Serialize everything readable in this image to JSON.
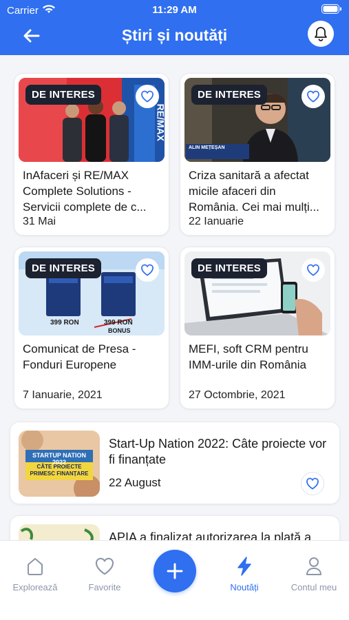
{
  "status_bar": {
    "carrier": "Carrier",
    "time": "11:29 AM"
  },
  "header": {
    "title": "Știri și noutăți"
  },
  "colors": {
    "accent": "#2f6ff0",
    "badge_bg": "#1c2230",
    "inactive": "#8d96a8"
  },
  "grid_articles": [
    {
      "badge": "DE INTERES",
      "title": "InAfaceri și RE/MAX Complete Solutions - Servicii complete de c...",
      "date": "31 Mai",
      "image_text": "RE/MAX"
    },
    {
      "badge": "DE INTERES",
      "title": "Criza sanitară a afectat micile afaceri din România. Cei mai mulți...",
      "date": "22 Ianuarie",
      "image_text": "ALIN MEȚEȘAN"
    },
    {
      "badge": "DE INTERES",
      "title": "Comunicat de Presa - Fonduri Europene",
      "date": "7 Ianuarie, 2021",
      "image_price1": "399 RON",
      "image_price2": "399 RON",
      "image_bonus": "BONUS"
    },
    {
      "badge": "DE INTERES",
      "title": "MEFI, soft CRM pentru IMM-urile din România",
      "date": "27 Octombrie, 2021"
    }
  ],
  "list_articles": [
    {
      "title": "Start-Up Nation 2022: Câte proiecte vor fi finanțate",
      "date": "22 August",
      "image_line1": "STARTUP NATION 2022",
      "image_line2": "CÂTE PROIECTE PRIMESC FINANȚARE"
    },
    {
      "title": "APIA a finalizat autorizarea la plată a",
      "date": ""
    }
  ],
  "tabs": [
    {
      "label": "Explorează",
      "icon": "home-icon",
      "active": false
    },
    {
      "label": "Favorite",
      "icon": "heart-icon",
      "active": false
    },
    {
      "label": "",
      "icon": "plus-icon",
      "active": false
    },
    {
      "label": "Noutăți",
      "icon": "bolt-icon",
      "active": true
    },
    {
      "label": "Contul meu",
      "icon": "user-icon",
      "active": false
    }
  ]
}
